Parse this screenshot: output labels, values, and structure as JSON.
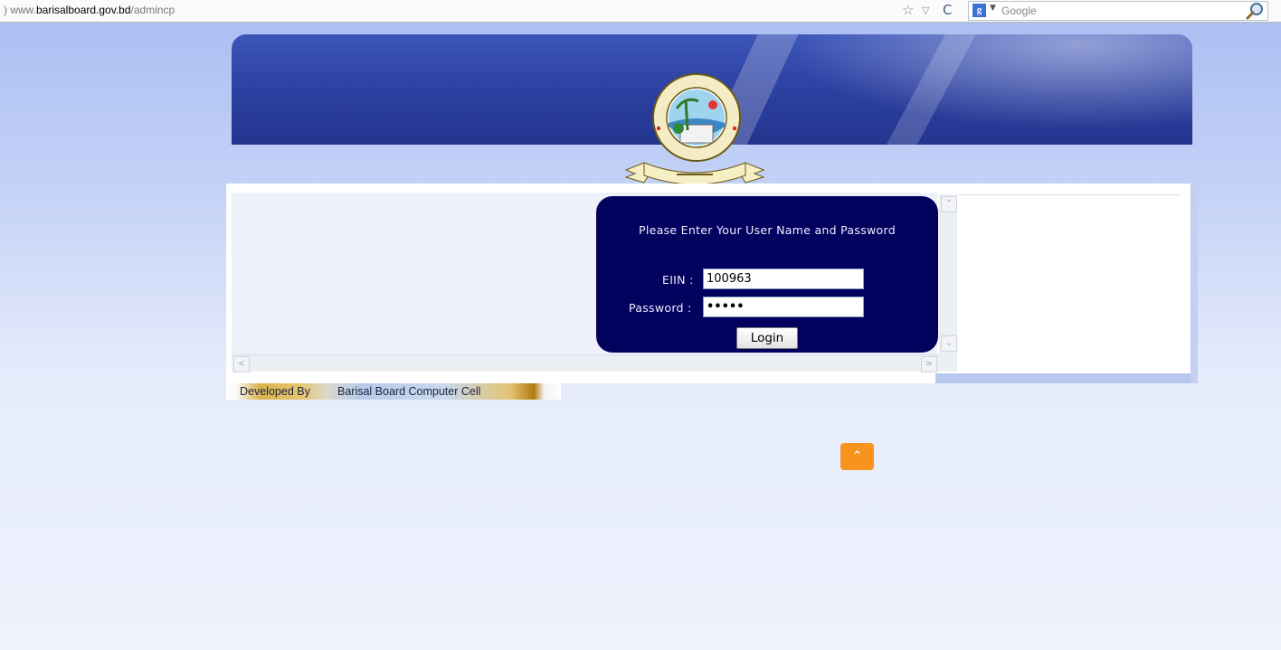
{
  "browser": {
    "url_prefix": ") www.",
    "url_host": "barisalboard.gov.bd",
    "url_path": "/admincp",
    "search_engine_label": "Google",
    "search_engine_icon": "g",
    "icons": [
      "star-icon",
      "dropdown-arrow-icon",
      "reload-icon",
      "magnifier-icon"
    ]
  },
  "header": {
    "logo_icon": "board-seal-logo"
  },
  "login": {
    "prompt": "Please Enter Your User Name and Password",
    "eiin_label": "EIIN :",
    "eiin_value": "100963",
    "password_label": "Password :",
    "password_value": "•••••",
    "login_button": "Login"
  },
  "footer": {
    "developed_by": "Developed By",
    "developer": "Barisal Board Computer Cell",
    "back_to_top_icon": "chevron-up-icon"
  },
  "colors": {
    "login_panel": "#02025e",
    "back_to_top": "#f7931e",
    "banner": "#2b3f9f"
  }
}
